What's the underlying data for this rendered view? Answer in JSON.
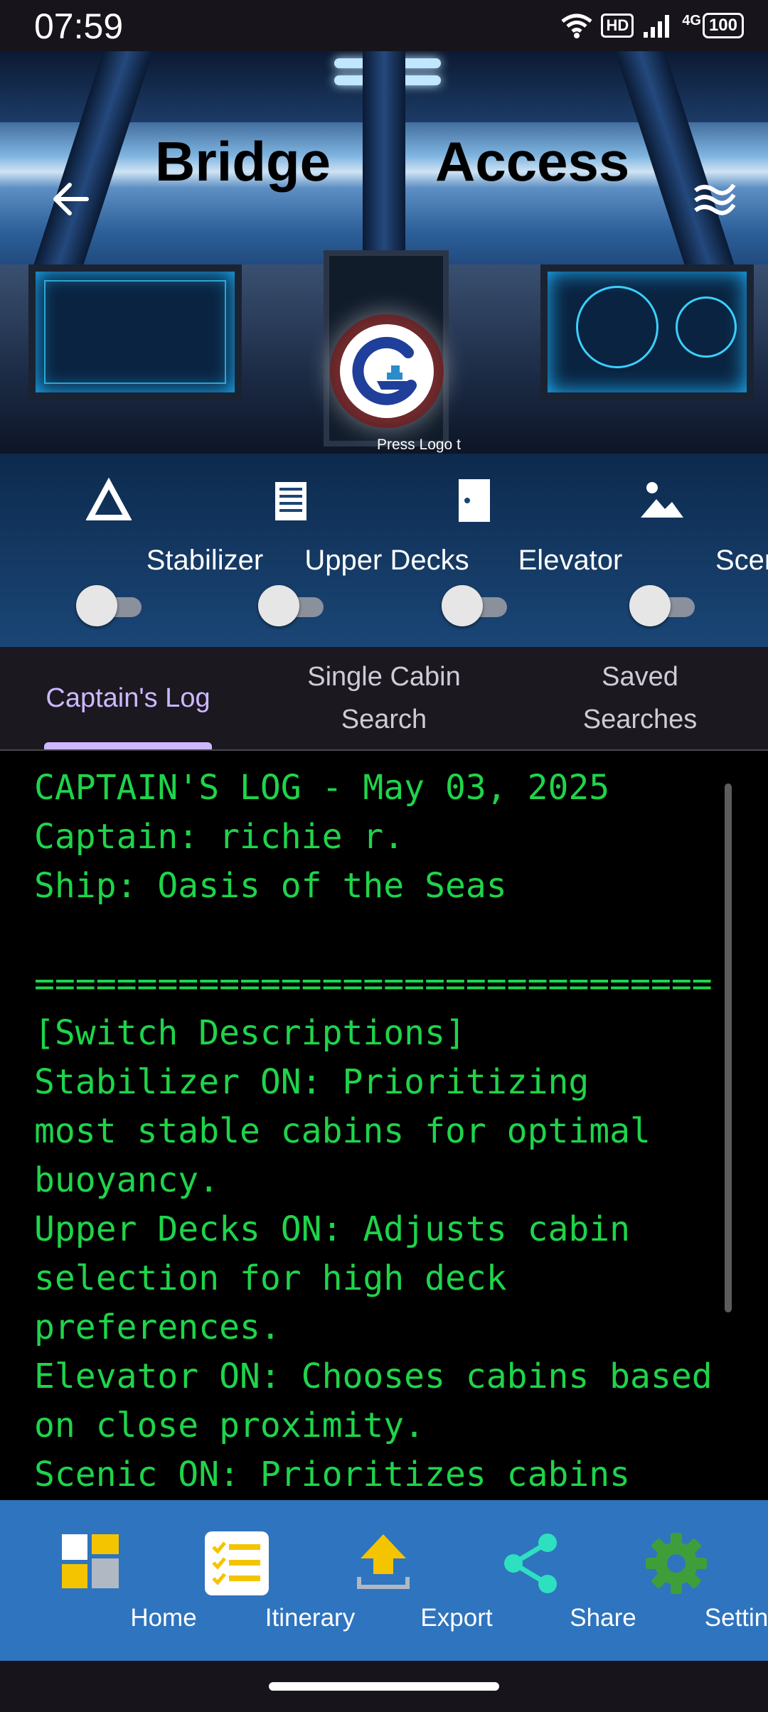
{
  "status": {
    "time": "07:59",
    "network": "HD",
    "signal": "4G",
    "battery": "100"
  },
  "header": {
    "title_left": "Bridge",
    "title_right": "Access",
    "press_logo": "Press Logo t"
  },
  "toggles": [
    {
      "label": "Stabilizer",
      "icon": "triangle-icon",
      "on": false
    },
    {
      "label": "Upper Decks",
      "icon": "list-icon",
      "on": false
    },
    {
      "label": "Elevator",
      "icon": "door-icon",
      "on": false
    },
    {
      "label": "Scenic",
      "icon": "landscape-icon",
      "on": false
    }
  ],
  "tabs": [
    {
      "label": "Captain's Log",
      "active": true
    },
    {
      "label": "Single Cabin\nSearch",
      "active": false
    },
    {
      "label": "Saved\nSearches",
      "active": false
    }
  ],
  "log": {
    "text": "CAPTAIN'S LOG - May 03, 2025\nCaptain: richie r.\nShip: Oasis of the Seas\n\n=================================\n[Switch Descriptions]\nStabilizer ON: Prioritizing\nmost stable cabins for optimal\nbuoyancy.\nUpper Decks ON: Adjusts cabin\nselection for high deck\npreferences.\nElevator ON: Chooses cabins based\non close proximity.\nScenic ON: Prioritizes cabins"
  },
  "bottom_nav": [
    {
      "label": "Home",
      "icon": "home-grid-icon"
    },
    {
      "label": "Itinerary",
      "icon": "checklist-icon"
    },
    {
      "label": "Export",
      "icon": "upload-icon"
    },
    {
      "label": "Share",
      "icon": "share-icon"
    },
    {
      "label": "Settings",
      "icon": "gear-icon"
    }
  ],
  "colors": {
    "log_text": "#1fd44a",
    "tab_active": "#cdb8ff",
    "nav_bg": "#2f74be",
    "toggle_panel": "#1a4676"
  }
}
